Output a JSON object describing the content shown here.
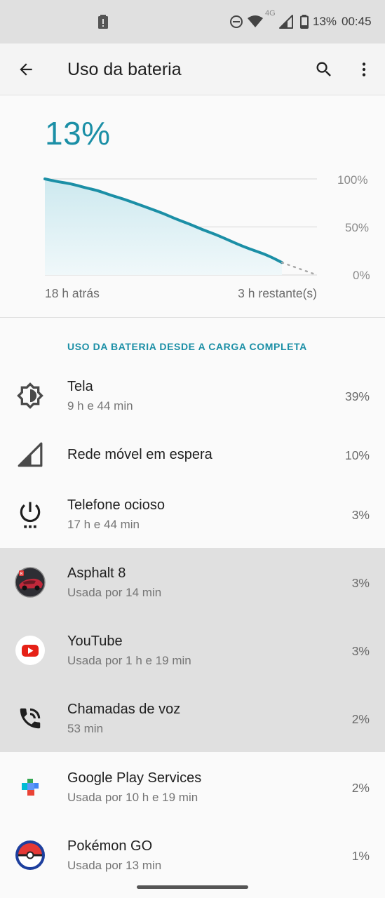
{
  "status_bar": {
    "battery_text": "13%",
    "time": "00:45",
    "network": "4G",
    "icons": [
      "battery-alert-icon",
      "dnd-icon",
      "wifi-icon",
      "signal-icon",
      "battery-icon"
    ]
  },
  "app_bar": {
    "title": "Uso da bateria",
    "back_icon": "arrow-back-icon",
    "search_icon": "search-icon",
    "more_icon": "more-vert-icon"
  },
  "summary": {
    "level": "13%",
    "axis_labels": [
      "100%",
      "50%",
      "0%"
    ],
    "start_label": "18 h atrás",
    "end_label": "3 h restante(s)"
  },
  "chart_data": {
    "type": "area",
    "xlabel": "",
    "ylabel": "",
    "ylim": [
      0,
      100
    ],
    "x_labels": [
      "18 h atrás",
      "3 h restante(s)"
    ],
    "series": [
      {
        "values": [
          100,
          97,
          95,
          91,
          88,
          83,
          79,
          74,
          69,
          64,
          58,
          53,
          47,
          42,
          36,
          30,
          25,
          20,
          13
        ]
      },
      {
        "values": [
          13,
          0
        ],
        "style": "dotted-projection"
      }
    ],
    "colors": {
      "line": "#1b8fa6",
      "fill": "#dff1f5"
    }
  },
  "section_title": "USO DA BATERIA DESDE A CARGA COMPLETA",
  "items": [
    {
      "title": "Tela",
      "subtitle": "9 h e 44 min",
      "percent": "39%",
      "icon": "brightness-icon"
    },
    {
      "title": "Rede móvel em espera",
      "subtitle": "",
      "percent": "10%",
      "icon": "cell-signal-icon"
    },
    {
      "title": "Telefone ocioso",
      "subtitle": "17 h e 44 min",
      "percent": "3%",
      "icon": "power-icon"
    },
    {
      "title": "Asphalt 8",
      "subtitle": "Usada por 14 min",
      "percent": "3%",
      "icon": "asphalt-8-icon"
    },
    {
      "title": "YouTube",
      "subtitle": "Usada por 1 h e 19 min",
      "percent": "3%",
      "icon": "youtube-icon"
    },
    {
      "title": "Chamadas de voz",
      "subtitle": "53 min",
      "percent": "2%",
      "icon": "phone-call-icon"
    },
    {
      "title": "Google Play Services",
      "subtitle": "Usada por 10 h e 19 min",
      "percent": "2%",
      "icon": "google-play-services-icon"
    },
    {
      "title": "Pokémon GO",
      "subtitle": "Usada por 13 min",
      "percent": "1%",
      "icon": "pokeball-icon"
    }
  ],
  "colors": {
    "accent": "#1b8fa6",
    "highlight": "#e0e0e0"
  }
}
